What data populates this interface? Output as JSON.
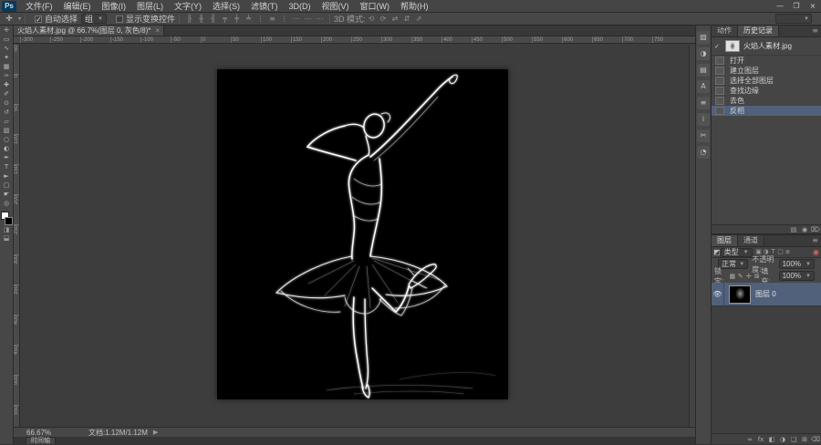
{
  "colors": {
    "selection": "#51617c",
    "chrome": "#474747",
    "canvas_bg": "#000000",
    "logo_bg": "#0a3a55"
  },
  "menubar": {
    "logo": "Ps",
    "items": [
      "文件(F)",
      "编辑(E)",
      "图像(I)",
      "图层(L)",
      "文字(Y)",
      "选择(S)",
      "滤镜(T)",
      "3D(D)",
      "视图(V)",
      "窗口(W)",
      "帮助(H)"
    ],
    "window_controls": [
      {
        "name": "minimize-button",
        "glyph": "—"
      },
      {
        "name": "restore-button",
        "glyph": "❐"
      },
      {
        "name": "close-button",
        "glyph": "×"
      }
    ]
  },
  "optionsbar": {
    "tool_icon": "✛",
    "tool_caret": "▾",
    "auto_select_check": "✓",
    "auto_select_label": "自动选择",
    "group_value": "组",
    "caret": "▼",
    "show_transform_label": "显示变换控件",
    "align_icons": [
      {
        "name": "align-left-edges-icon",
        "glyph": "╟"
      },
      {
        "name": "align-horizontal-centers-icon",
        "glyph": "╫"
      },
      {
        "name": "align-right-edges-icon",
        "glyph": "╢"
      },
      {
        "name": "align-top-edges-icon",
        "glyph": "╤"
      },
      {
        "name": "align-vertical-centers-icon",
        "glyph": "╪"
      },
      {
        "name": "align-bottom-edges-icon",
        "glyph": "╧"
      },
      {
        "name": "distribute-top-icon",
        "glyph": "⋮"
      },
      {
        "name": "distribute-vertical-icon",
        "glyph": "≡"
      },
      {
        "name": "distribute-bottom-icon",
        "glyph": "⋮"
      },
      {
        "name": "distribute-left-icon",
        "glyph": "⋯"
      },
      {
        "name": "distribute-horizontal-icon",
        "glyph": "⋯"
      },
      {
        "name": "distribute-right-icon",
        "glyph": "⋯"
      }
    ],
    "threed_label": "3D 模式:",
    "threed_icons": [
      {
        "name": "3d-rotate-icon",
        "glyph": "⟲"
      },
      {
        "name": "3d-roll-icon",
        "glyph": "⟳"
      },
      {
        "name": "3d-drag-icon",
        "glyph": "⇄"
      },
      {
        "name": "3d-slide-icon",
        "glyph": "⇵"
      },
      {
        "name": "3d-scale-icon",
        "glyph": "⇗"
      }
    ]
  },
  "document": {
    "tab_title": "火焰人素材.jpg @ 66.7%(图层 0, 灰色/8)*",
    "tab_close": "×"
  },
  "toolbar": {
    "tools": [
      {
        "name": "move-tool",
        "glyph": "✛"
      },
      {
        "name": "marquee-tool",
        "glyph": "▭"
      },
      {
        "name": "lasso-tool",
        "glyph": "∿"
      },
      {
        "name": "quick-selection-tool",
        "glyph": "✦"
      },
      {
        "name": "crop-tool",
        "glyph": "▦"
      },
      {
        "name": "eyedropper-tool",
        "glyph": "✑"
      },
      {
        "name": "healing-brush-tool",
        "glyph": "✚"
      },
      {
        "name": "brush-tool",
        "glyph": "✐"
      },
      {
        "name": "clone-stamp-tool",
        "glyph": "⊙"
      },
      {
        "name": "history-brush-tool",
        "glyph": "↺"
      },
      {
        "name": "eraser-tool",
        "glyph": "▱"
      },
      {
        "name": "gradient-tool",
        "glyph": "▨"
      },
      {
        "name": "blur-tool",
        "glyph": "○"
      },
      {
        "name": "dodge-tool",
        "glyph": "◐"
      },
      {
        "name": "pen-tool",
        "glyph": "✒"
      },
      {
        "name": "type-tool",
        "glyph": "T"
      },
      {
        "name": "path-selection-tool",
        "glyph": "►"
      },
      {
        "name": "shape-tool",
        "glyph": "▢"
      },
      {
        "name": "hand-tool",
        "glyph": "☛"
      },
      {
        "name": "zoom-tool",
        "glyph": "◎"
      }
    ],
    "quick_mask_glyph": "◨",
    "screen_mode_glyph": "⬓"
  },
  "rulers": {
    "h_labels": [
      "-300",
      "-250",
      "-200",
      "-150",
      "-100",
      "-50",
      "0",
      "50",
      "100",
      "150",
      "200",
      "250",
      "300",
      "350",
      "400",
      "450",
      "500",
      "550",
      "600",
      "650",
      "700",
      "750"
    ],
    "v_labels": [
      "-50",
      "0",
      "50",
      "100",
      "150",
      "200",
      "250",
      "300",
      "350",
      "400",
      "450",
      "500",
      "550"
    ]
  },
  "dockstrip": {
    "icons": [
      {
        "name": "color-panel-icon",
        "glyph": "▧"
      },
      {
        "name": "adjustments-panel-icon",
        "glyph": "◑"
      },
      {
        "name": "styles-panel-icon",
        "glyph": "▤"
      },
      {
        "name": "character-panel-icon",
        "glyph": "A"
      },
      {
        "name": "paragraph-panel-icon",
        "glyph": "≡"
      },
      {
        "name": "info-panel-icon",
        "glyph": "i"
      },
      {
        "name": "properties-panel-icon",
        "glyph": "✂"
      },
      {
        "name": "clone-source-panel-icon",
        "glyph": "◔"
      }
    ]
  },
  "history_panel": {
    "tabs": {
      "left": "动作",
      "active": "历史记录"
    },
    "panel_menu_glyph": "≡",
    "snapshot_check": "✓",
    "snapshot_name": "火焰人素材.jpg",
    "items": [
      {
        "label": "打开"
      },
      {
        "label": "建立图层"
      },
      {
        "label": "选择全部图层"
      },
      {
        "label": "查找边缘"
      },
      {
        "label": "去色"
      },
      {
        "label": "反相",
        "selected": true
      }
    ],
    "footer_icons": [
      {
        "name": "new-document-from-state-icon",
        "glyph": "▤"
      },
      {
        "name": "new-snapshot-icon",
        "glyph": "◉"
      },
      {
        "name": "delete-state-icon",
        "glyph": "⌦"
      }
    ]
  },
  "layers_panel": {
    "tabs": {
      "active": "图层",
      "right": "通道"
    },
    "panel_menu_glyph": "≡",
    "filter_kind_icon": "◩",
    "filter_label": "类型",
    "filter_caret": "▼",
    "filter_icons": [
      {
        "name": "filter-pixel-layers-icon",
        "glyph": "▣"
      },
      {
        "name": "filter-adjustment-layers-icon",
        "glyph": "◑"
      },
      {
        "name": "filter-type-layers-icon",
        "glyph": "T"
      },
      {
        "name": "filter-shape-layers-icon",
        "glyph": "▢"
      },
      {
        "name": "filter-smart-objects-icon",
        "glyph": "⧈"
      }
    ],
    "blend_mode": "正常",
    "opacity_label": "不透明度:",
    "opacity_value": "100%",
    "lock_label": "锁定:",
    "lock_icons": [
      {
        "name": "lock-transparent-icon",
        "glyph": "▦"
      },
      {
        "name": "lock-pixels-icon",
        "glyph": "✎"
      },
      {
        "name": "lock-position-icon",
        "glyph": "✛"
      },
      {
        "name": "lock-all-icon",
        "glyph": "⊠"
      }
    ],
    "fill_label": "填充:",
    "fill_value": "100%",
    "layer": {
      "eye": "👁",
      "name": "图层 0"
    },
    "footer_icons": [
      {
        "name": "link-layers-icon",
        "glyph": "∞"
      },
      {
        "name": "layer-effects-icon",
        "glyph": "fx"
      },
      {
        "name": "layer-mask-icon",
        "glyph": "◧"
      },
      {
        "name": "adjustment-layer-icon",
        "glyph": "◑"
      },
      {
        "name": "new-group-icon",
        "glyph": "❑"
      },
      {
        "name": "new-layer-icon",
        "glyph": "⊞"
      },
      {
        "name": "delete-layer-icon",
        "glyph": "⌫"
      }
    ]
  },
  "statusbar": {
    "zoom": "66.67%",
    "doc_info": "文档:1.12M/1.12M",
    "arrow": "▶"
  },
  "timeline": {
    "label": "时间轴"
  }
}
